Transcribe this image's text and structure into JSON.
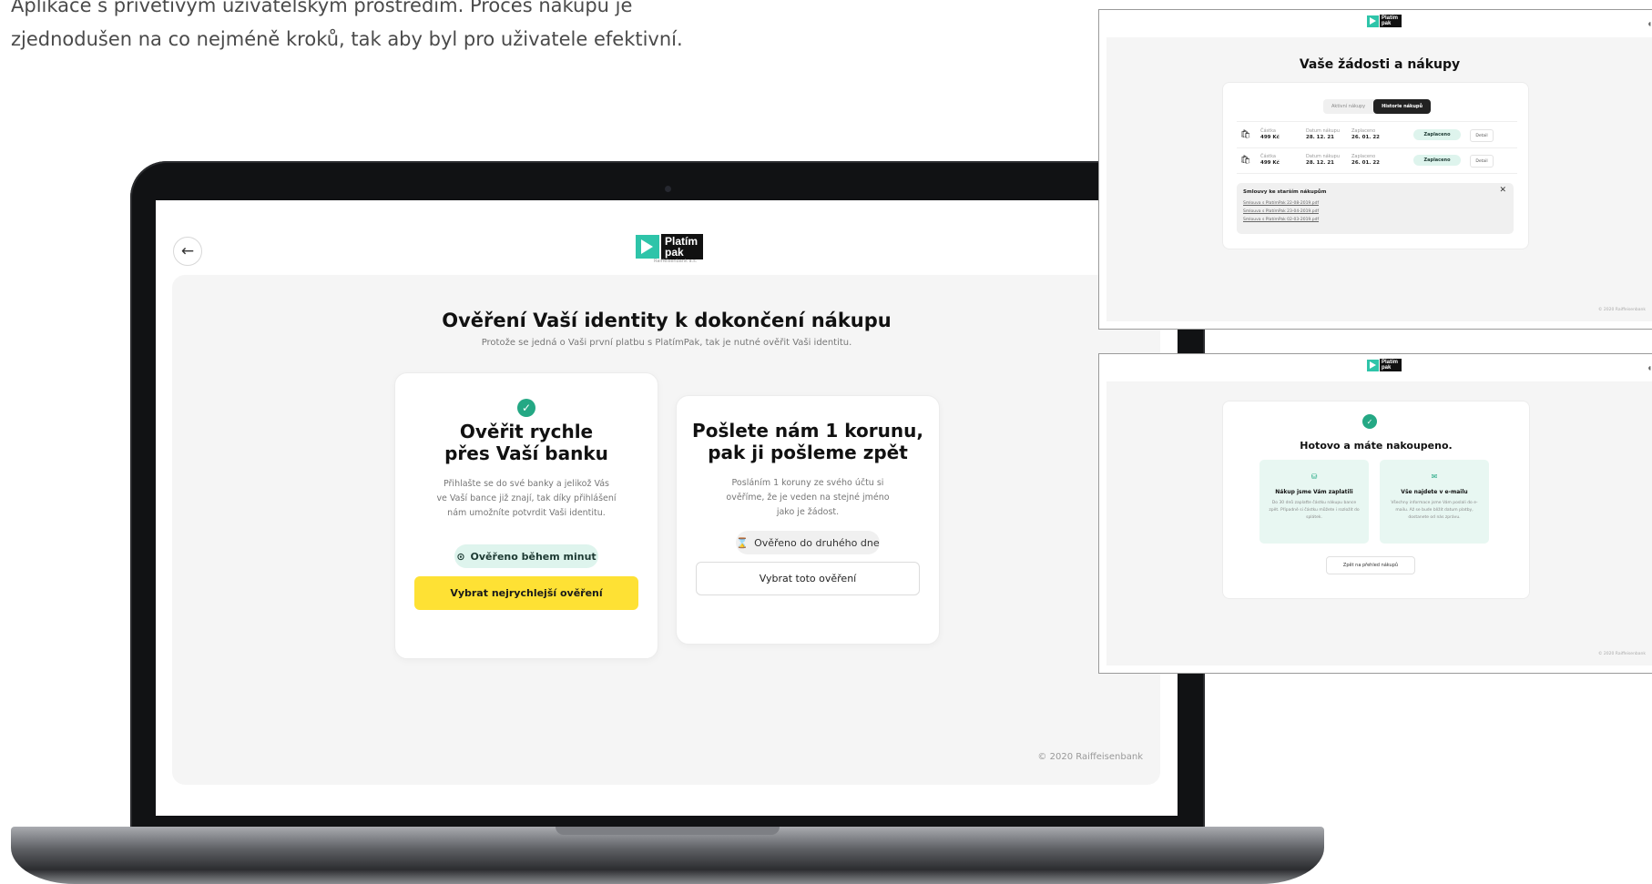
{
  "intro": {
    "line1": "Aplikace s přívětivým uživatelským prostředím. Proces nákupu je",
    "line2": "zjednodušen na co nejméně kroků, tak aby byl pro uživatele efektivní."
  },
  "brand": {
    "logo_line1": "Platím",
    "logo_line2": "pak",
    "logo_sub": "Raiffeisenbank a.s.",
    "accent": "#2ec4a9",
    "yellow": "#fee134",
    "green": "#24a884"
  },
  "main": {
    "back_icon": "←",
    "title": "Ověření Vaší identity k dokončení nákupu",
    "subtitle": "Protože se jedná o Vaši první platbu s PlatímPak, tak je nutné ověřit Vaši identitu.",
    "card_bank": {
      "check_icon": "✓",
      "title_line1": "Ověřit rychle",
      "title_line2": "přes Vaší banku",
      "desc_line1": "Přihlašte se do své banky a jelikož Vás",
      "desc_line2": "ve Vaší bance již znají, tak díky přihlášení",
      "desc_line3": "nám umožníte potvrdit Vaši identitu.",
      "badge_icon": "⊙",
      "badge": "Ověřeno během minut",
      "button": "Vybrat nejrychlejší ověření"
    },
    "card_coin": {
      "title_line1": "Pošlete nám 1 korunu,",
      "title_line2": "pak ji pošleme zpět",
      "desc_line1": "Posláním 1 koruny ze svého účtu si",
      "desc_line2": "ověříme, že je veden na stejné jméno",
      "desc_line3": "jako je žádost.",
      "badge_icon": "⌛",
      "badge": "Ověřeno do druhého dne",
      "button": "Vybrat toto ověření"
    },
    "footer": "© 2020 Raiffeisenbank"
  },
  "preview_history": {
    "title": "Vaše žádosti a nákupy",
    "tabs": [
      "Aktivní nákupy",
      "Historie nákupů"
    ],
    "rows": [
      {
        "amount_label": "Částka",
        "amount": "499 Kč",
        "date_label": "Datum nákupu",
        "date": "28. 12. 21",
        "paid_label": "Zaplaceno",
        "paid": "26. 01. 22",
        "status": "Zaplaceno",
        "detail": "Detail"
      },
      {
        "amount_label": "Částka",
        "amount": "499 Kč",
        "date_label": "Datum nákupu",
        "date": "28. 12. 21",
        "paid_label": "Zaplaceno",
        "paid": "26. 01. 22",
        "status": "Zaplaceno",
        "detail": "Detail"
      }
    ],
    "contracts_title": "Smlouvy ke starším nákupům",
    "contracts": [
      "Smlouva s PlatímPak 22-08-2019.pdf",
      "Smlouva s PlatímPak 23-04-2019.pdf",
      "Smlouva s PlatímPak 02-03-2019.pdf"
    ],
    "close_icon": "✕",
    "footer": "© 2020 Raiffeisenbank"
  },
  "preview_done": {
    "check_icon": "✓",
    "title": "Hotovo a máte nakoupeno.",
    "card1": {
      "icon": "⛁",
      "title": "Nákup jsme Vám zaplatili",
      "desc": "Do 30 dnů zaplaťte částku nákupu bance zpět. Případně si částku můžete i rozložit do splátek."
    },
    "card2": {
      "icon": "✉",
      "title": "Vše najdete v e-mailu",
      "desc": "Všechny informace jsme Vám poslali do e-mailu. Až se bude blížit datum platby, dostanete od nás zprávu."
    },
    "button": "Zpět na přehled nákupů",
    "footer": "© 2020 Raiffeisenbank"
  }
}
